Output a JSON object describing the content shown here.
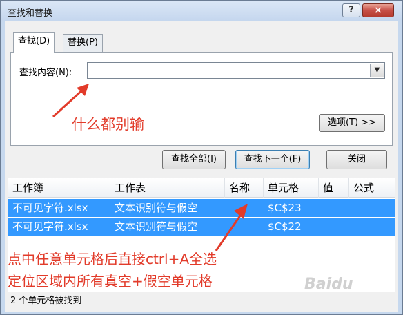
{
  "window": {
    "title": "查找和替换",
    "help_label": "?",
    "close_label": "×"
  },
  "tabs": [
    {
      "label": "查找(D)",
      "active": true
    },
    {
      "label": "替换(P)",
      "active": false
    }
  ],
  "find": {
    "label": "查找内容(N):",
    "value": "",
    "placeholder": "",
    "dropdown_glyph": "▼"
  },
  "buttons": {
    "options": "选项(T) >>",
    "find_all": "查找全部(I)",
    "find_next": "查找下一个(F)",
    "close": "关闭"
  },
  "results": {
    "columns": [
      "工作簿",
      "工作表",
      "名称",
      "单元格",
      "值",
      "公式"
    ],
    "rows": [
      {
        "workbook": "不可见字符.xlsx",
        "sheet": "文本识别符与假空",
        "name": "",
        "cell": "$C$23",
        "value": "",
        "formula": ""
      },
      {
        "workbook": "不可见字符.xlsx",
        "sheet": "文本识别符与假空",
        "name": "",
        "cell": "$C$22",
        "value": "",
        "formula": ""
      }
    ]
  },
  "status": "2 个单元格被找到",
  "annotations": {
    "empty_note": "什么都别输",
    "select_note_line1": "点中任意单元格后直接ctrl+A全选",
    "select_note_line2": "定位区域内所有真空+假空单元格"
  },
  "watermark": "Baidu",
  "colors": {
    "selection": "#3399ff",
    "annotation": "#e23b2a",
    "titlebar": "#c4d6ee",
    "close_button": "#c75048"
  }
}
